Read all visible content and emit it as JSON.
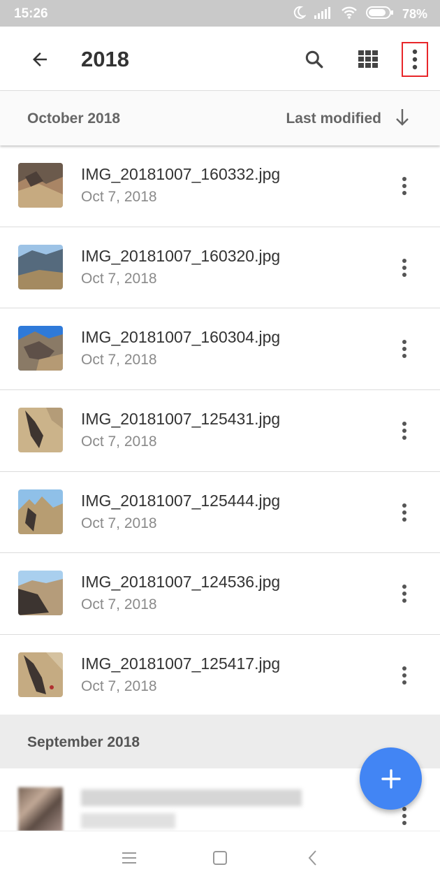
{
  "status_bar": {
    "time": "15:26",
    "battery": "78%",
    "icons": [
      "moon-icon",
      "signal-icon",
      "wifi-icon",
      "battery-icon"
    ]
  },
  "app_bar": {
    "title": "2018",
    "icons": [
      "back-arrow-icon",
      "search-icon",
      "grid-view-icon",
      "more-vert-icon"
    ],
    "highlight_color": "#e8262a"
  },
  "sort_bar": {
    "section": "October 2018",
    "sort_label": "Last modified",
    "sort_icon": "arrow-down-icon"
  },
  "files": [
    {
      "name": "IMG_20181007_160332.jpg",
      "date": "Oct 7, 2018"
    },
    {
      "name": "IMG_20181007_160320.jpg",
      "date": "Oct 7, 2018"
    },
    {
      "name": "IMG_20181007_160304.jpg",
      "date": "Oct 7, 2018"
    },
    {
      "name": "IMG_20181007_125431.jpg",
      "date": "Oct 7, 2018"
    },
    {
      "name": "IMG_20181007_125444.jpg",
      "date": "Oct 7, 2018"
    },
    {
      "name": "IMG_20181007_124536.jpg",
      "date": "Oct 7, 2018"
    },
    {
      "name": "IMG_20181007_125417.jpg",
      "date": "Oct 7, 2018"
    }
  ],
  "section2": {
    "label": "September 2018"
  },
  "fab": {
    "icon": "plus-icon",
    "color": "#4285f4"
  },
  "nav_bar": {
    "icons": [
      "menu-icon",
      "home-square-icon",
      "back-chevron-icon"
    ]
  }
}
